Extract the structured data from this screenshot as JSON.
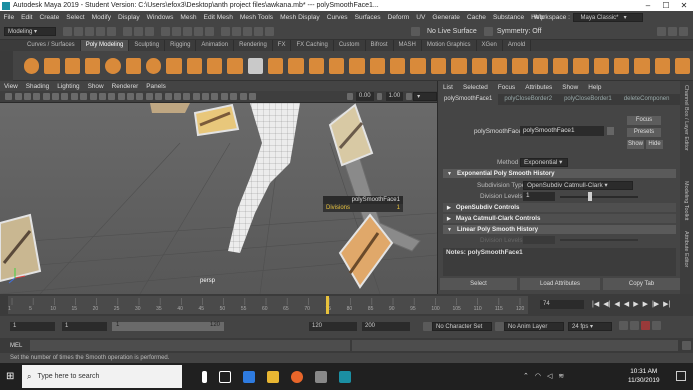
{
  "title_bar": {
    "text": "Autodesk Maya 2019 - Student Version: C:\\Users\\efox3\\Desktop\\anth project files\\awkana.mb* ---  polySmoothFace1..."
  },
  "menu_bar": {
    "items": [
      "File",
      "Edit",
      "Create",
      "Select",
      "Modify",
      "Display",
      "Windows",
      "Mesh",
      "Edit Mesh",
      "Mesh Tools",
      "Mesh Display",
      "Curves",
      "Surfaces",
      "Deform",
      "UV",
      "Generate",
      "Cache",
      "Substance",
      "Help"
    ],
    "workspace_label": "Workspace :",
    "workspace_value": "Maya Classic*"
  },
  "status_line": {
    "mode": "Modeling",
    "live_surface": "No Live Surface",
    "symmetry": "Symmetry: Off"
  },
  "shelf_tabs": [
    "Curves / Surfaces",
    "Poly Modeling",
    "Sculpting",
    "Rigging",
    "Animation",
    "Rendering",
    "FX",
    "FX Caching",
    "Custom",
    "Bifrost",
    "MASH",
    "Motion Graphics",
    "XGen",
    "Arnold"
  ],
  "active_shelf_tab": "Poly Modeling",
  "panel_menu": [
    "View",
    "Shading",
    "Lighting",
    "Show",
    "Renderer",
    "Panels"
  ],
  "panel_toolbar": {
    "exposure": "0.00",
    "gamma": "1.00"
  },
  "viewport": {
    "camera": "persp",
    "hud_title": "polySmoothFace1",
    "hud_attr": "Divisions",
    "hud_value": "1"
  },
  "attribute_editor": {
    "menu": [
      "List",
      "Selected",
      "Focus",
      "Attributes",
      "Show",
      "Help"
    ],
    "tabs": [
      "polySmoothFace1",
      "polyCloseBorder2",
      "polyCloseBorder1",
      "deleteComponen"
    ],
    "node_label": "polySmoothFace:",
    "node_value": "polySmoothFace1",
    "focus_label": "Focus",
    "presets_label": "Presets",
    "show_label": "Show",
    "hide_label": "Hide",
    "method_label": "Method",
    "method_value": "Exponential",
    "sections": [
      "Exponential Poly Smooth History",
      "OpenSubdiv Controls",
      "Maya Catmull-Clark Controls",
      "Linear Poly Smooth History"
    ],
    "subdiv_type_label": "Subdivision Type",
    "subdiv_type_value": "OpenSubdiv Catmull-Clark",
    "division_levels_label": "Division Levels",
    "division_levels_value": "1",
    "division_levels_label2": "Division Levels",
    "notes": "Notes: polySmoothFace1",
    "buttons": [
      "Select",
      "Load Attributes",
      "Copy Tab"
    ]
  },
  "side_tabs": [
    "Channel Box / Layer Editor",
    "Modeling Toolkit",
    "Attribute Editor"
  ],
  "time_slider": {
    "ticks": [
      "1",
      "5",
      "10",
      "15",
      "20",
      "25",
      "30",
      "35",
      "40",
      "45",
      "50",
      "55",
      "60",
      "65",
      "70",
      "75",
      "80",
      "85",
      "90",
      "95",
      "100",
      "105",
      "110",
      "115",
      "120"
    ],
    "current": "74"
  },
  "range_slider": {
    "start": "1",
    "start2": "1",
    "range_start": "1",
    "range_end": "120",
    "end": "120",
    "end2": "200",
    "character_set": "No Character Set",
    "anim_layer": "No Anim Layer",
    "fps": "24 fps"
  },
  "command_line": {
    "lang": "MEL"
  },
  "help_line": "Set the number of times the Smooth operation is performed.",
  "taskbar": {
    "search_placeholder": "Type here to search",
    "time": "10:31 AM",
    "date": "11/30/2019"
  },
  "colors": {
    "accent": "#5285a6",
    "highlight": "#e8c23c",
    "timeline_marker": "#e8c23c"
  }
}
